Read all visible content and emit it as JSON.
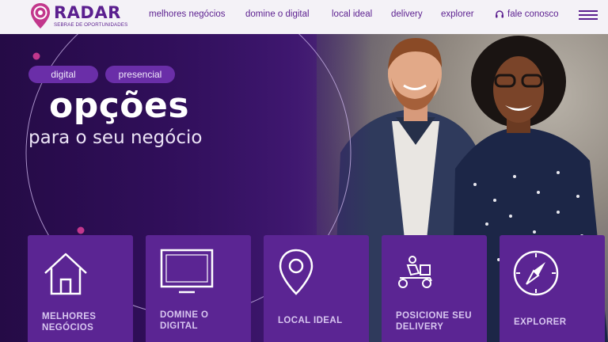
{
  "logo": {
    "name": "RADAR",
    "tagline": "SEBRAE DE OPORTUNIDADES"
  },
  "nav": {
    "items": [
      {
        "label": "melhores negócios"
      },
      {
        "label": "domine o digital"
      },
      {
        "label": "local ideal"
      },
      {
        "label": "delivery"
      },
      {
        "label": "explorer"
      }
    ],
    "contact_label": "fale conosco",
    "contact_icon": "headset-icon",
    "menu_icon": "hamburger-menu-icon"
  },
  "hero": {
    "pills": [
      "digital",
      "presencial"
    ],
    "headline": "opções",
    "subheadline": "para o seu negócio"
  },
  "cards": [
    {
      "label": "MELHORES NEGÓCIOS",
      "icon": "house-icon"
    },
    {
      "label": "DOMINE O DIGITAL",
      "icon": "monitor-icon"
    },
    {
      "label": "LOCAL IDEAL",
      "icon": "location-pin-icon"
    },
    {
      "label": "POSICIONE SEU DELIVERY",
      "icon": "delivery-scooter-icon"
    },
    {
      "label": "EXPLORER",
      "icon": "compass-icon"
    }
  ],
  "colors": {
    "brand": "#5b1f8f",
    "card": "#5b2593",
    "pill": "#6a2ea8",
    "accent_pink": "#c2378c"
  }
}
